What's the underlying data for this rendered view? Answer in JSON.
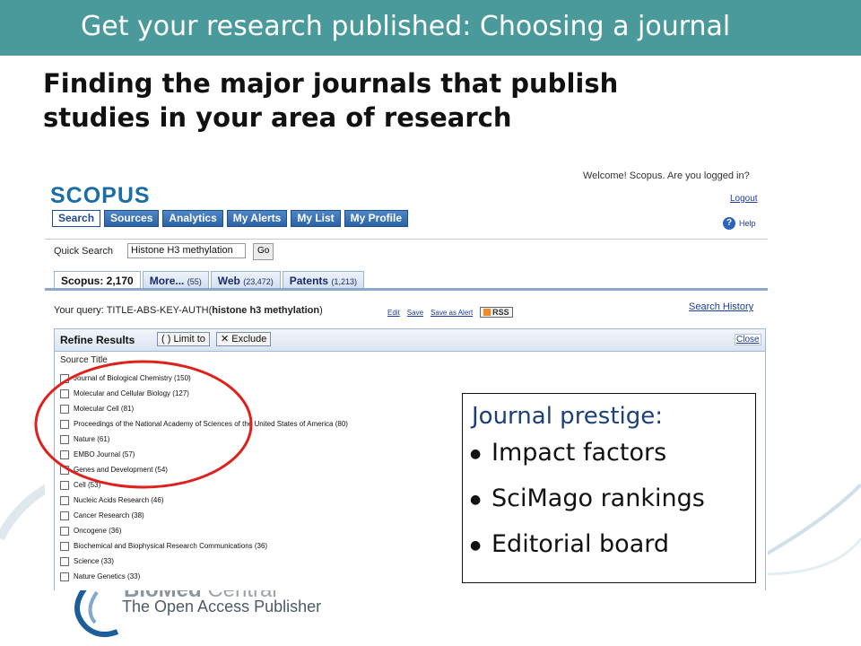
{
  "slide": {
    "banner_title": "Get your research published: Choosing a journal",
    "subtitle": "Finding the major journals that publish studies in your area of research",
    "brand_color": "#4a9a9c",
    "footer": {
      "name_part1": "BioMed",
      "name_part2": " Central",
      "tagline": "The Open Access Publisher"
    }
  },
  "scopus": {
    "logo": "SCOPUS",
    "top_clip_text": "Welcome! Scopus. Are you logged in?",
    "logout": "Logout",
    "help": "Help",
    "nav": [
      "Search",
      "Sources",
      "Analytics",
      "My Alerts",
      "My List",
      "My Profile"
    ],
    "quick_search": {
      "label": "Quick Search",
      "value": "Histone H3 methylation",
      "go": "Go"
    },
    "tabs": [
      {
        "label": "Scopus: 2,170",
        "count": ""
      },
      {
        "label": "More...",
        "count": "(55)"
      },
      {
        "label": "Web",
        "count": "(23,472)"
      },
      {
        "label": "Patents",
        "count": "(1,213)"
      }
    ],
    "query": {
      "prefix": "Your query: TITLE-ABS-KEY-AUTH(",
      "term": "histone h3 methylation",
      "suffix": ")"
    },
    "query_links": {
      "edit": "Edit",
      "save": "Save",
      "alert": "Save as Alert",
      "rss": "RSS"
    },
    "search_history": "Search History",
    "refine": {
      "title": "Refine Results",
      "limit": "Limit to",
      "exclude": "Exclude",
      "close": "Close",
      "source_title": "Source Title",
      "sources": [
        "Journal of Biological Chemistry (150)",
        "Molecular and Cellular Biology (127)",
        "Molecular Cell (81)",
        "Proceedings of the National Academy of Sciences of the United States of America (80)",
        "Nature (61)",
        "EMBO Journal (57)",
        "Genes and Development (54)",
        "Cell (53)",
        "Nucleic Acids Research (46)",
        "Cancer Research (38)",
        "Oncogene (36)",
        "Biochemical and Biophysical Research Communications (36)",
        "Science (33)",
        "Nature Genetics (33)"
      ]
    }
  },
  "callout": {
    "title": "Journal prestige:",
    "items": [
      "Impact factors",
      "SciMago rankings",
      "Editorial board"
    ]
  }
}
